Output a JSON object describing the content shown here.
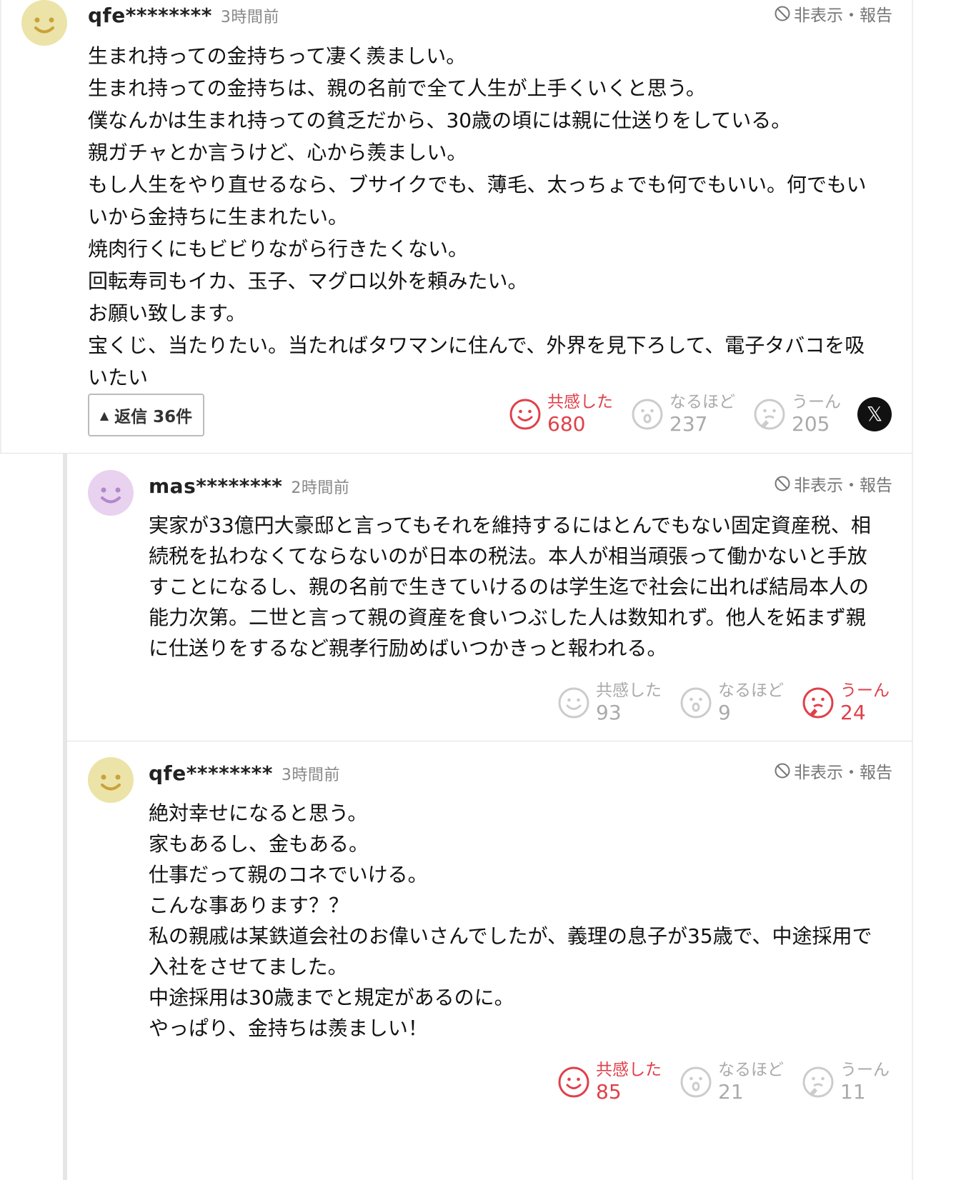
{
  "hide_report_label": "非表示・報告",
  "comments": [
    {
      "username": "qfe********",
      "time": "3時間前",
      "lines": [
        "生まれ持っての金持ちって凄く羨ましい。",
        "生まれ持っての金持ちは、親の名前で全て人生が上手くいくと思う。",
        "僕なんかは生まれ持っての貧乏だから、30歳の頃には親に仕送りをしている。",
        "親ガチャとか言うけど、心から羨ましい。",
        "もし人生をやり直せるなら、ブサイクでも、薄毛、太っちょでも何でもいい。何でもい",
        "いから金持ちに生まれたい。",
        "焼肉行くにもビビりながら行きたくない。",
        "回転寿司もイカ、玉子、マグロ以外を頼みたい。",
        "お願い致します。",
        "宝くじ、当たりたい。当たればタワマンに住んで、外界を見下ろして、電子タバコを吸",
        "いたい"
      ],
      "reply_button": "返信 36件",
      "reactions": [
        {
          "label": "共感した",
          "count": "680",
          "active": true
        },
        {
          "label": "なるほど",
          "count": "237",
          "active": false
        },
        {
          "label": "うーん",
          "count": "205",
          "active": false
        }
      ],
      "share_icon": "x-logo-icon"
    },
    {
      "username": "mas********",
      "time": "2時間前",
      "lines": [
        "実家が33億円大豪邸と言ってもそれを維持するにはとんでもない固定資産税、相",
        "続税を払わなくてならないのが日本の税法。本人が相当頑張って働かないと手放",
        "すことになるし、親の名前で生きていけるのは学生迄で社会に出れば結局本人の",
        "能力次第。二世と言って親の資産を食いつぶした人は数知れず。他人を妬まず親",
        "に仕送りをするなど親孝行励めばいつかきっと報われる。"
      ],
      "reactions": [
        {
          "label": "共感した",
          "count": "93",
          "active": false
        },
        {
          "label": "なるほど",
          "count": "9",
          "active": false
        },
        {
          "label": "うーん",
          "count": "24",
          "active": true
        }
      ]
    },
    {
      "username": "qfe********",
      "time": "3時間前",
      "lines": [
        "絶対幸せになると思う。",
        "家もあるし、金もある。",
        "仕事だって親のコネでいける。",
        "こんな事あります？？",
        "私の親戚は某鉄道会社のお偉いさんでしたが、義理の息子が35歳で、中途採用で",
        "入社をさせてました。",
        "中途採用は30歳までと規定があるのに。",
        "やっぱり、金持ちは羨ましい！"
      ],
      "reactions": [
        {
          "label": "共感した",
          "count": "85",
          "active": true
        },
        {
          "label": "なるほど",
          "count": "21",
          "active": false
        },
        {
          "label": "うーん",
          "count": "11",
          "active": false
        }
      ]
    }
  ],
  "colors": {
    "active": "#e0404a",
    "inactive": "#aaaaaa",
    "avatar_yellow": "#ece3a8",
    "avatar_purple": "#e8d2ef"
  }
}
